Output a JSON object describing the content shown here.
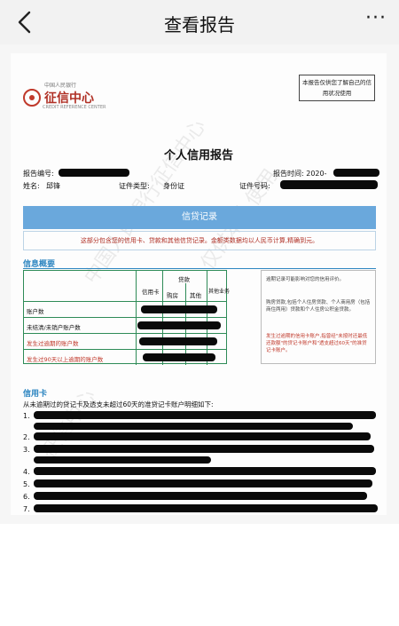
{
  "nav": {
    "title": "查看报告",
    "more_label": "···"
  },
  "report": {
    "logo": {
      "top_text": "中国人民银行",
      "name": "征信中心",
      "subtitle": "CREDIT REFERENCE CENTER"
    },
    "notice": "本报告仅供您了解自己的信用状况使用",
    "title": "个人信用报告",
    "meta": {
      "report_no_label": "报告编号:",
      "report_time_label": "报告时间: 2020-",
      "name_label": "姓名:",
      "name_value": "邱锋",
      "id_type_label": "证件类型:",
      "id_type_value": "身份证",
      "id_no_label": "证件号码:"
    },
    "band_title": "信贷记录",
    "band_note": "这部分包含您的信用卡、贷款和其他信贷记录。金额类数据均以人民币计算,精确到元。",
    "summary": {
      "heading": "信息概要",
      "col_headers": {
        "credit_card": "信用卡",
        "loan": "贷款",
        "housing": "购房",
        "other": "其他",
        "other_business": "其他业务"
      },
      "rows": [
        "账户数",
        "未结清/未销户账户数",
        "发生过逾期的账户数",
        "发生过90天以上逾期的账户数"
      ],
      "notes": [
        "逾期记录可能影响对您的信用评价。",
        "购房贷款,包括个人住房贷款、个人商用房（包括商住两用）贷款和个人住房公积金贷款。",
        "发生过逾期的信用卡账户,指曾经\"未按时还最低还款额\"的贷记卡账户和\"透支超过60天\"的准贷记卡账户。"
      ]
    },
    "credit_card": {
      "heading": "信用卡",
      "intro": "从未逾期过的贷记卡及透支未超过60天的准贷记卡账户明细如下:",
      "item_numbers": [
        "1.",
        "2.",
        "3.",
        "4.",
        "5.",
        "6.",
        "7."
      ]
    },
    "watermarks": [
      "中国人民银行征信中心",
      "仅供本人使用",
      "征信中心"
    ],
    "colors": {
      "band": "#6aa8dc",
      "section": "#2e86c1",
      "table_border": "#2e8b57",
      "seal": "#c0392b"
    }
  }
}
